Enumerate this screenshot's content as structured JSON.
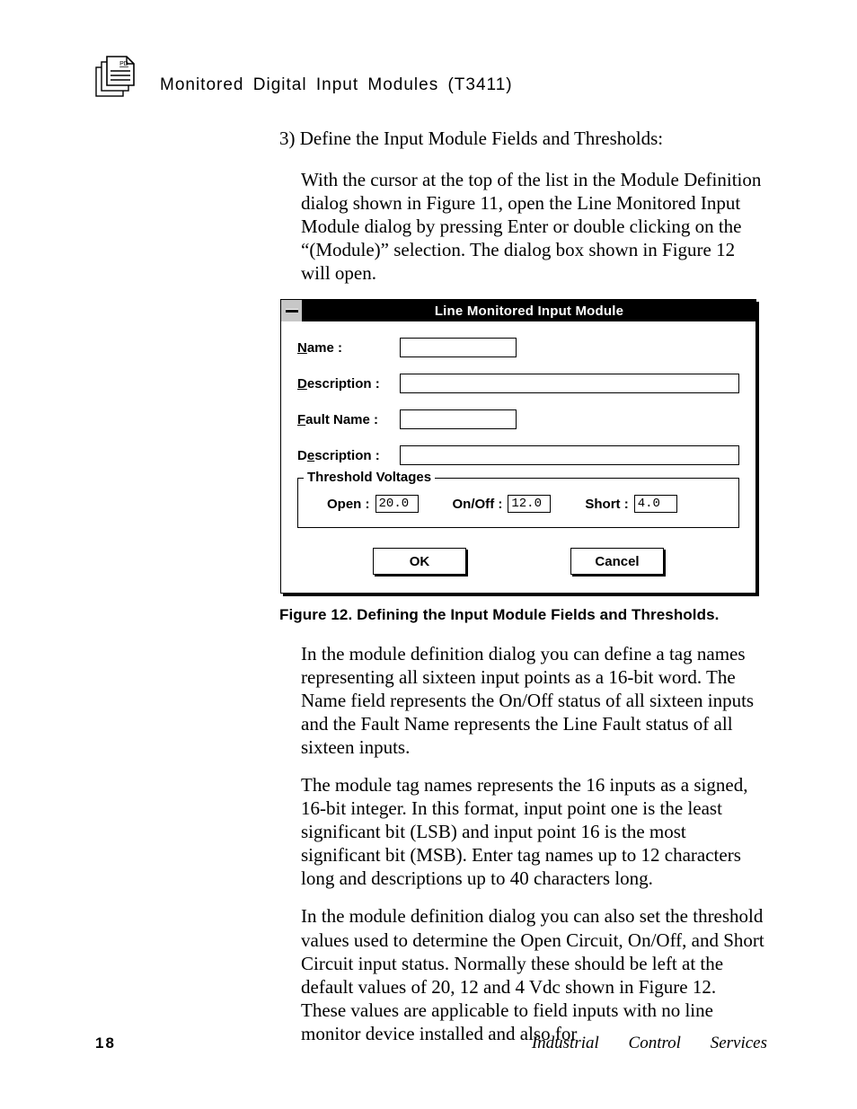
{
  "header": {
    "icon_badge": "PD",
    "title": "Monitored  Digital  Input  Modules (T3411)"
  },
  "step": {
    "number": "3)",
    "heading": "Define the Input Module Fields and Thresholds:",
    "intro": "With the cursor at the top of the list in the Module Definition dialog shown in Figure 11, open the Line Monitored Input Module dialog by pressing Enter or double clicking on the “(Module)” selection.  The dialog box shown in Figure 12 will open."
  },
  "dialog": {
    "title": "Line Monitored Input Module",
    "fields": {
      "name_label_pre": "N",
      "name_label_post": "ame :",
      "desc1_label_pre": "D",
      "desc1_label_post": "escription :",
      "fault_label_pre": "F",
      "fault_label_post": "ault Name :",
      "desc2_label_pre": "D",
      "desc2_label_mid": "e",
      "desc2_label_post": "scription :",
      "name_value": "",
      "desc1_value": "",
      "fault_value": "",
      "desc2_value": ""
    },
    "thresholds": {
      "legend_pre": "Threshold ",
      "legend_ul": "V",
      "legend_post": "oltages",
      "open_label_pre": "O",
      "open_label_post": "pen :",
      "open_value": "20.0",
      "onoff_label_pre": "On/Of",
      "onoff_label_ul": "f",
      "onoff_label_post": " :",
      "onoff_value": "12.0",
      "short_label_pre": "S",
      "short_label_ul": "h",
      "short_label_post": "ort :",
      "short_value": "4.0"
    },
    "buttons": {
      "ok": "OK",
      "cancel": "Cancel"
    }
  },
  "caption": "Figure 12.  Defining the Input Module Fields and Thresholds.",
  "paragraphs": {
    "p1": "In the module definition dialog you can define a tag names representing all sixteen input points as a 16-bit word.  The Name field represents the On/Off status of all sixteen inputs and the Fault Name represents the Line Fault status of all sixteen inputs.",
    "p2": "The module tag names represents the 16 inputs as a signed, 16-bit integer.  In this format, input point one is the least significant bit (LSB) and input point 16 is the most significant bit (MSB).  Enter tag names up to 12 characters long and descriptions up to 40 characters long.",
    "p3": "In the module definition dialog you can also set the threshold values used to determine the Open Circuit, On/Off, and Short Circuit input status.  Normally these should be left at the default values of 20, 12 and 4 Vdc shown in Figure 12.  These values are applicable to field inputs with no line monitor device installed and also for"
  },
  "footer": {
    "page": "18",
    "right": "Industrial Control Services"
  }
}
